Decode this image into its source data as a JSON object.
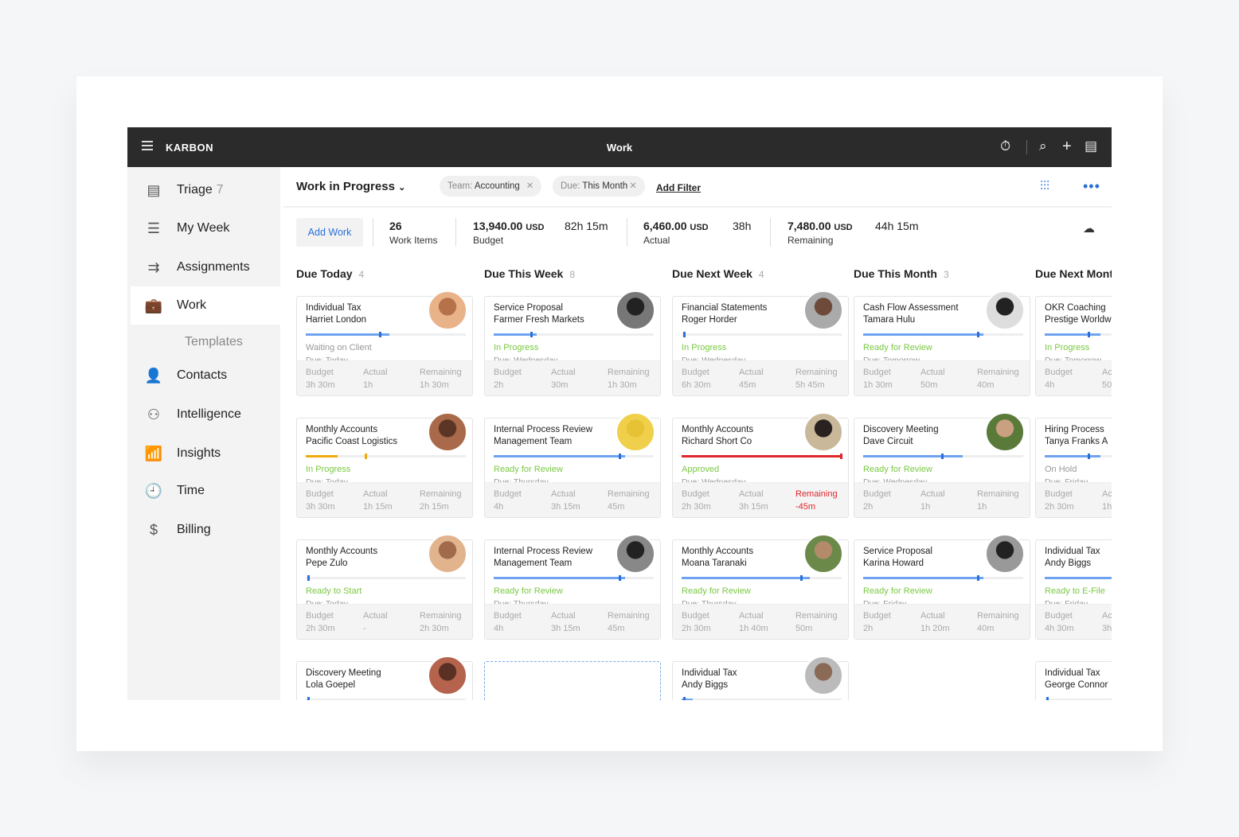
{
  "colors": {
    "accent": "#2a6fdb",
    "status_green": "#7ac943",
    "status_gray": "#999999",
    "progress_blue": "#6ea3ef",
    "progress_orange": "#f0a90e",
    "overrun_red": "#e0262b"
  },
  "topbar": {
    "brand": "KARBON",
    "title": "Work",
    "icons": [
      "menu-icon",
      "timer-icon",
      "search-icon",
      "plus-icon",
      "notes-icon"
    ]
  },
  "sidebar": {
    "items": [
      {
        "label": "Triage",
        "count": "7",
        "icon": "triage-icon",
        "glyph": "▤"
      },
      {
        "label": "My Week",
        "icon": "list-icon",
        "glyph": "☰"
      },
      {
        "label": "Assignments",
        "icon": "assign-icon",
        "glyph": "⇉"
      },
      {
        "label": "Work",
        "icon": "briefcase-icon",
        "glyph": "💼",
        "active": true
      },
      {
        "label": "Templates",
        "sub": true
      },
      {
        "label": "Contacts",
        "icon": "person-icon",
        "glyph": "👤"
      },
      {
        "label": "Intelligence",
        "icon": "network-icon",
        "glyph": "⚇"
      },
      {
        "label": "Insights",
        "icon": "bar-chart-icon",
        "glyph": "📶"
      },
      {
        "label": "Time",
        "icon": "clock-icon",
        "glyph": "🕘"
      },
      {
        "label": "Billing",
        "icon": "dollar-icon",
        "glyph": "$"
      }
    ]
  },
  "header": {
    "view": "Work in Progress",
    "filters": [
      {
        "key": "Team:",
        "value": "Accounting"
      },
      {
        "key": "Due:",
        "value": "This Month"
      }
    ],
    "add_filter": "Add Filter"
  },
  "summary": {
    "add_work": "Add Work",
    "items_count": "26",
    "items_label": "Work Items",
    "budget": {
      "amount": "13,940.00",
      "currency": "USD",
      "hours": "82h 15m",
      "label": "Budget"
    },
    "actual": {
      "amount": "6,460.00",
      "currency": "USD",
      "hours": "38h",
      "label": "Actual"
    },
    "remaining": {
      "amount": "7,480.00",
      "currency": "USD",
      "hours": "44h 15m",
      "label": "Remaining"
    }
  },
  "labels": {
    "budget": "Budget",
    "actual": "Actual",
    "remaining": "Remaining"
  },
  "columns": [
    {
      "title": "Due Today",
      "count": "4",
      "cards": [
        {
          "type": "Individual Tax",
          "client": "Harriet London",
          "status": "Waiting on Client",
          "status_color": "gray",
          "due": "Due: Today",
          "progress": 0.52,
          "marker": 0.46,
          "bar": "blue",
          "budget": "3h 30m",
          "actual": "1h",
          "remaining": "1h 30m",
          "avatar": [
            "#e9b38a",
            "#b5714a"
          ]
        },
        {
          "type": "Monthly Accounts",
          "client": "Pacific Coast Logistics",
          "status": "In Progress",
          "status_color": "green",
          "due": "Due: Today",
          "progress": 0.2,
          "marker": 0.37,
          "bar": "orange",
          "budget": "3h 30m",
          "actual": "1h 15m",
          "remaining": "2h 15m",
          "avatar": [
            "#a86a4a",
            "#5b3526"
          ]
        },
        {
          "type": "Monthly Accounts",
          "client": "Pepe Zulo",
          "status": "Ready to Start",
          "status_color": "green",
          "due": "Due: Today",
          "progress": 0,
          "marker": 0.01,
          "bar": "blue",
          "budget": "2h 30m",
          "actual": "-",
          "remaining": "2h 30m",
          "avatar": [
            "#e2b48e",
            "#a06a4b"
          ]
        },
        {
          "type": "Discovery Meeting",
          "client": "Lola Goepel",
          "progress": 0,
          "marker": 0.01,
          "bar": "blue",
          "avatar": [
            "#b5634d",
            "#5a2f24"
          ]
        }
      ]
    },
    {
      "title": "Due This Week",
      "count": "8",
      "cards": [
        {
          "type": "Service Proposal",
          "client": "Farmer Fresh Markets",
          "status": "In Progress",
          "status_color": "green",
          "due": "Due: Wednesday",
          "progress": 0.27,
          "marker": 0.23,
          "bar": "blue",
          "budget": "2h",
          "actual": "30m",
          "remaining": "1h 30m",
          "avatar": [
            "#777",
            "#222"
          ]
        },
        {
          "type": "Internal Process Review",
          "client": "Management Team",
          "status": "Ready for Review",
          "status_color": "green",
          "due": "Due: Thursday",
          "progress": 0.82,
          "marker": 0.78,
          "bar": "blue",
          "budget": "4h",
          "actual": "3h 15m",
          "remaining": "45m",
          "avatar": [
            "#f0d04a",
            "#e6c234"
          ]
        },
        {
          "type": "Internal Process Review",
          "client": "Management Team",
          "status": "Ready for Review",
          "status_color": "green",
          "due": "Due: Thursday",
          "progress": 0.82,
          "marker": 0.78,
          "bar": "blue",
          "budget": "4h",
          "actual": "3h 15m",
          "remaining": "45m",
          "avatar": [
            "#888",
            "#222"
          ]
        }
      ],
      "placeholder": true
    },
    {
      "title": "Due Next Week",
      "count": "4",
      "cards": [
        {
          "type": "Financial Statements",
          "client": "Roger Horder",
          "status": "In Progress",
          "status_color": "green",
          "due": "Due: Wednesday",
          "progress": 0,
          "marker": 0.01,
          "bar": "blue",
          "budget": "6h 30m",
          "actual": "45m",
          "remaining": "5h 45m",
          "avatar": [
            "#aaa",
            "#6d4a3a"
          ]
        },
        {
          "type": "Monthly Accounts",
          "client": "Richard Short Co",
          "status": "Approved",
          "status_color": "green",
          "due": "Due: Wednesday",
          "progress": 1,
          "marker": 0.99,
          "bar": "red",
          "budget": "2h 30m",
          "actual": "3h 15m",
          "remaining": "-45m",
          "overrun": true,
          "avatar": [
            "#c9b89a",
            "#2a2220"
          ]
        },
        {
          "type": "Monthly Accounts",
          "client": "Moana Taranaki",
          "status": "Ready for Review",
          "status_color": "green",
          "due": "Due: Thursday",
          "progress": 0.8,
          "marker": 0.74,
          "bar": "blue",
          "budget": "2h 30m",
          "actual": "1h 40m",
          "remaining": "50m",
          "avatar": [
            "#6b8a4a",
            "#b38a6a"
          ]
        },
        {
          "type": "Individual Tax",
          "client": "Andy Biggs",
          "progress": 0.07,
          "marker": 0.01,
          "bar": "blue",
          "avatar": [
            "#bbb",
            "#8a6a55"
          ]
        }
      ]
    },
    {
      "title": "Due This Month",
      "count": "3",
      "cards": [
        {
          "type": "Cash Flow Assessment",
          "client": "Tamara Hulu",
          "status": "Ready for Review",
          "status_color": "green",
          "due": "Due: Tomorrow",
          "progress": 0.75,
          "marker": 0.71,
          "bar": "blue",
          "budget": "1h 30m",
          "actual": "50m",
          "remaining": "40m",
          "avatar": [
            "#ddd",
            "#222"
          ]
        },
        {
          "type": "Discovery Meeting",
          "client": "Dave Circuit",
          "status": "Ready for Review",
          "status_color": "green",
          "due": "Due: Wednesday",
          "progress": 0.62,
          "marker": 0.49,
          "bar": "blue",
          "budget": "2h",
          "actual": "1h",
          "remaining": "1h",
          "avatar": [
            "#5a7a3a",
            "#c9a080"
          ]
        },
        {
          "type": "Service Proposal",
          "client": "Karina Howard",
          "status": "Ready for Review",
          "status_color": "green",
          "due": "Due: Friday",
          "progress": 0.75,
          "marker": 0.71,
          "bar": "blue",
          "budget": "2h",
          "actual": "1h 20m",
          "remaining": "40m",
          "avatar": [
            "#999",
            "#222"
          ]
        }
      ]
    },
    {
      "title": "Due Next Month",
      "cards": [
        {
          "type": "OKR Coaching",
          "client": "Prestige Worldwide",
          "status": "In Progress",
          "status_color": "green",
          "due": "Due: Tomorrow",
          "progress": 0.35,
          "marker": 0.27,
          "bar": "blue",
          "budget": "4h",
          "actual": "50m"
        },
        {
          "type": "Hiring Process",
          "client": "Tanya Franks A",
          "status": "On Hold",
          "status_color": "gray",
          "due": "Due: Friday",
          "progress": 0.35,
          "marker": 0.27,
          "bar": "blue",
          "budget": "2h 30m",
          "actual": "1h"
        },
        {
          "type": "Individual Tax",
          "client": "Andy Biggs",
          "status": "Ready to E-File",
          "status_color": "green",
          "due": "Due: Friday",
          "progress": 1,
          "marker": 0.99,
          "bar": "blue",
          "budget": "4h 30m",
          "actual": "3h"
        },
        {
          "type": "Individual Tax",
          "client": "George Connor",
          "progress": 0,
          "marker": 0.01,
          "bar": "blue"
        }
      ]
    }
  ]
}
